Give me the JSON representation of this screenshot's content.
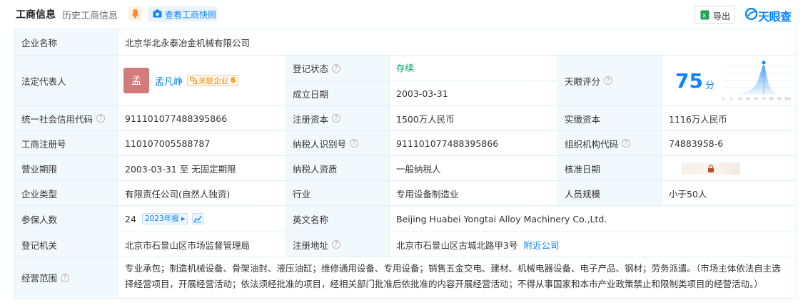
{
  "header": {
    "title": "工商信息",
    "history": "历史工商信息",
    "snapshot": "查看工商快照",
    "export": "导出",
    "brand": "天眼查"
  },
  "colors": {
    "accent": "#0a84ff",
    "label_bg": "#f2f9fc",
    "status_green": "#00a870",
    "avatar": "#d37a7a"
  },
  "fields": {
    "company_name_label": "企业名称",
    "company_name": "北京华北永泰冶金机械有限公司",
    "legal_rep_label": "法定代表人",
    "legal_rep_avatar": "孟",
    "legal_rep": "孟凡峥",
    "related_label": "关联企业",
    "related_count": "6",
    "status_label": "登记状态",
    "status": "存续",
    "est_date_label": "成立日期",
    "est_date": "2003-03-31",
    "score_label": "天眼评分",
    "score": "75",
    "score_unit": "分",
    "score_axis": [
      "0",
      "1",
      "10",
      "30",
      "50",
      "70",
      "80",
      "90",
      "100"
    ],
    "credit_code_label": "统一社会信用代码",
    "credit_code": "911101077488395866",
    "reg_capital_label": "注册资本",
    "reg_capital": "1500万人民币",
    "paid_capital_label": "实缴资本",
    "paid_capital": "1116万人民币",
    "reg_no_label": "工商注册号",
    "reg_no": "110107005588787",
    "taxpayer_id_label": "纳税人识别号",
    "taxpayer_id": "911101077488395866",
    "org_code_label": "组织机构代码",
    "org_code": "74883958-6",
    "term_label": "营业期限",
    "term": "2003-03-31 至 无固定期限",
    "taxpayer_type_label": "纳税人资质",
    "taxpayer_type": "一般纳税人",
    "approval_date_label": "核准日期",
    "company_type_label": "企业类型",
    "company_type": "有限责任公司(自然人独资)",
    "industry_label": "行业",
    "industry": "专用设备制造业",
    "staff_size_label": "人员规模",
    "staff_size": "小于50人",
    "insured_label": "参保人数",
    "insured": "24",
    "insured_report": "2023年报",
    "english_name_label": "英文名称",
    "english_name": "Beijing Huabei Yongtai Alloy Machinery Co.,Ltd.",
    "authority_label": "登记机关",
    "authority": "北京市石景山区市场监督管理局",
    "address_label": "注册地址",
    "address": "北京市石景山区古城北路甲3号",
    "nearby": "附近公司",
    "scope_label": "经营范围",
    "scope": "专业承包；制造机械设备、骨架油封、液压油缸；维修通用设备、专用设备；销售五金交电、建材、机械电器设备、电子产品、钢材；劳务派遣。（市场主体依法自主选择经营项目，开展经营活动；依法须经批准的项目，经相关部门批准后依批准的内容开展经营活动；不得从事国家和本市产业政策禁止和限制类项目的经营活动。）"
  }
}
